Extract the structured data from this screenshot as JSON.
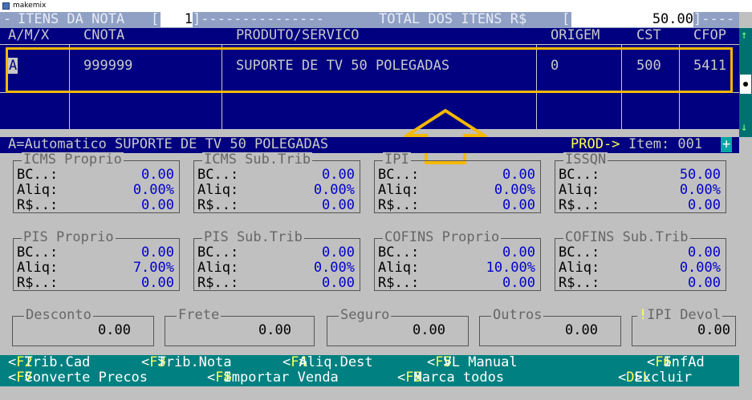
{
  "window": {
    "title": "makemix"
  },
  "header": {
    "items_label": "ITENS DA NOTA",
    "items_value": "1",
    "total_label": "TOTAL DOS ITENS R$",
    "total_value": "50.00"
  },
  "columns": [
    "A/M/X",
    "CNOTA",
    "PRODUTO/SERVICO",
    "ORIGEM",
    "CST",
    "CFOP"
  ],
  "rows": [
    {
      "amx": "A",
      "cnota": "999999",
      "produto": "SUPORTE DE TV 50 POLEGADAS",
      "origem": "0",
      "cst": "500",
      "cfop": "5411"
    }
  ],
  "status": {
    "text": "A=Automatico SUPORTE DE TV 50 POLEGADAS",
    "prod_label": "PROD->",
    "item_text": "Item: 001",
    "plus": "+"
  },
  "tax_boxes": [
    {
      "title": "ICMS Proprio",
      "rows": [
        {
          "label": "BC..:",
          "value": "0.00"
        },
        {
          "label": "Aliq:",
          "value": "0.00%"
        },
        {
          "label": "R$..:",
          "value": "0.00"
        }
      ]
    },
    {
      "title": "ICMS Sub.Trib",
      "rows": [
        {
          "label": "BC..:",
          "value": "0.00"
        },
        {
          "label": "Aliq:",
          "value": "0.00%"
        },
        {
          "label": "R$..:",
          "value": "0.00"
        }
      ]
    },
    {
      "title": "IPI",
      "rows": [
        {
          "label": "BC..:",
          "value": "0.00"
        },
        {
          "label": "Aliq:",
          "value": "0.00%"
        },
        {
          "label": "R$..:",
          "value": "0.00"
        }
      ]
    },
    {
      "title": "ISSQN",
      "rows": [
        {
          "label": "BC..:",
          "value": "50.00"
        },
        {
          "label": "Aliq:",
          "value": "0.00%"
        },
        {
          "label": "R$..:",
          "value": "0.00"
        }
      ]
    },
    {
      "title": "PIS Proprio",
      "rows": [
        {
          "label": "BC..:",
          "value": "0.00"
        },
        {
          "label": "Aliq:",
          "value": "7.00%"
        },
        {
          "label": "R$..:",
          "value": "0.00"
        }
      ]
    },
    {
      "title": "PIS Sub.Trib",
      "rows": [
        {
          "label": "BC..:",
          "value": "0.00"
        },
        {
          "label": "Aliq:",
          "value": "0.00%"
        },
        {
          "label": "R$..:",
          "value": "0.00"
        }
      ]
    },
    {
      "title": "COFINS Proprio",
      "rows": [
        {
          "label": "BC..:",
          "value": "0.00"
        },
        {
          "label": "Aliq:",
          "value": "10.00%"
        },
        {
          "label": "R$..:",
          "value": "0.00"
        }
      ]
    },
    {
      "title": "COFINS Sub.Trib",
      "rows": [
        {
          "label": "BC..:",
          "value": "0.00"
        },
        {
          "label": "Aliq:",
          "value": "0.00%"
        },
        {
          "label": "R$..:",
          "value": "0.00"
        }
      ]
    }
  ],
  "summary": [
    {
      "title": "Desconto",
      "value": "0.00"
    },
    {
      "title": "Frete",
      "value": "0.00"
    },
    {
      "title": "Seguro",
      "value": "0.00"
    },
    {
      "title": "Outros",
      "value": "0.00"
    },
    {
      "title": "IPI Devol",
      "value": "0.00",
      "mark": "!"
    }
  ],
  "fkeys_row1": [
    {
      "key": "F2",
      "label": "Trib.Cad"
    },
    {
      "key": "F3",
      "label": "Trib.Nota"
    },
    {
      "key": "F4",
      "label": "Aliq.Dest"
    },
    {
      "key": "F5",
      "label": "VL Manual"
    },
    {
      "key": "F6",
      "label": "InfAd"
    }
  ],
  "fkeys_row2": [
    {
      "key": "F7",
      "label": "Converte Precos"
    },
    {
      "key": "F8",
      "label": "Importar Venda"
    },
    {
      "key": "F9",
      "label": "Marca todos"
    },
    {
      "key": "DEL",
      "label": "Excluir"
    }
  ],
  "colors": {
    "grid_bg": "#000080",
    "highlight": "#f5b800",
    "fkey_bar": "#008080",
    "value_blue": "#0000cc"
  }
}
